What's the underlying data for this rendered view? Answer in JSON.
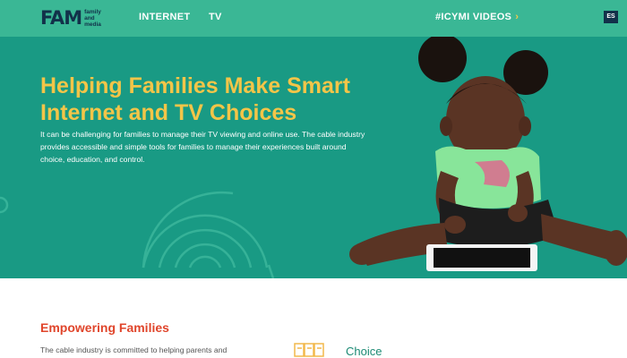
{
  "header": {
    "logo": {
      "mark": "FAM",
      "words": [
        "family",
        "and",
        "media"
      ]
    },
    "nav": [
      {
        "label": "INTERNET"
      },
      {
        "label": "TV"
      }
    ],
    "icymi": {
      "label": "#ICYMI VIDEOS",
      "chevron": "›"
    },
    "language": "ES"
  },
  "hero": {
    "title": "Helping Families Make Smart Internet and TV Choices",
    "body": "It can be challenging for families to manage their TV viewing and online use. The cable industry provides accessible and simple tools for families to manage their experiences built around choice, education, and control.",
    "image": "child-with-tablet-photo"
  },
  "section": {
    "title": "Empowering Families",
    "text": "The cable industry is committed to helping parents and",
    "feature": {
      "label": "Choice",
      "icon": "documents-icon"
    }
  },
  "colors": {
    "topbar": "#3ab795",
    "hero_bg": "#199a84",
    "title_yellow": "#f3c548",
    "accent_red": "#e0452b",
    "navy": "#12314a"
  }
}
